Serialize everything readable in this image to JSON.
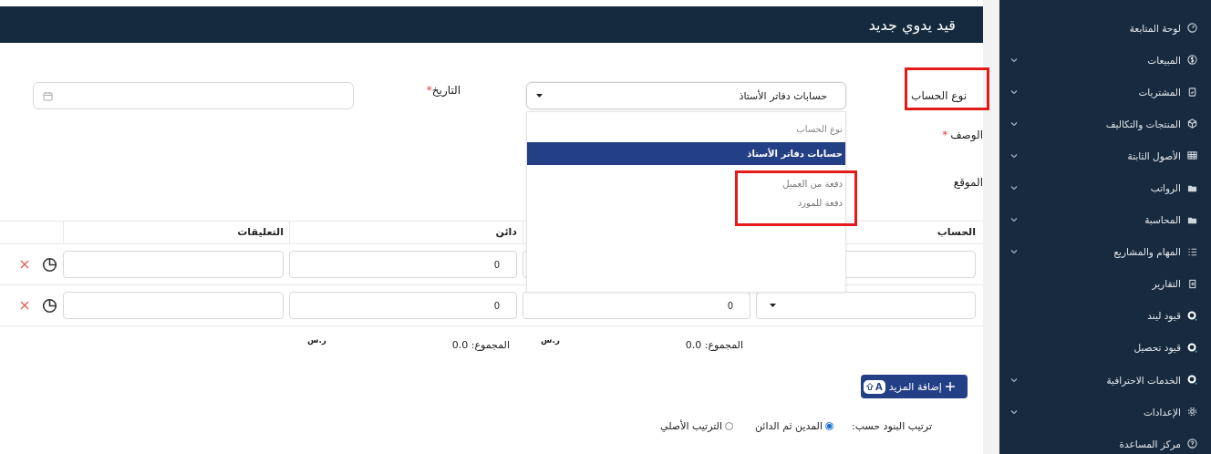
{
  "header": {
    "title": "قيد يدوي جديد"
  },
  "form": {
    "account_type": {
      "label": "نوع الحساب",
      "value": "حسابات دفاتر الأستاذ",
      "highlighted": true,
      "expanded": true,
      "options": [
        {
          "label": "نوع الحساب",
          "kind": "placeholder",
          "selected": false,
          "highlighted": false
        },
        {
          "label": "حسابات دفاتر الأستاذ",
          "kind": "option",
          "selected": true,
          "highlighted": false
        },
        {
          "label": "دفعة من العميل",
          "kind": "option",
          "selected": false,
          "highlighted": true
        },
        {
          "label": "دفعة للمورد",
          "kind": "option",
          "selected": false,
          "highlighted": true
        }
      ]
    },
    "date": {
      "label": "التاريخ",
      "required_mark": "*"
    },
    "description": {
      "label": "الوصف",
      "required_mark": "*"
    },
    "location": {
      "label": "الموقع"
    }
  },
  "table": {
    "columns": [
      {
        "label": "الحساب"
      },
      {},
      {
        "label": "دائن"
      },
      {
        "label": "التعليقات"
      }
    ],
    "rows": [
      {
        "account_field": {
          "kind": "text"
        },
        "credit": "0"
      },
      {
        "account_field": {
          "kind": "select"
        },
        "debit": "0",
        "credit": "0"
      }
    ],
    "totals": [
      {
        "label": "المجموع: 0.0",
        "currency": "ر.س"
      },
      {
        "label": "المجموع: 0.0",
        "currency": "ر.س"
      }
    ]
  },
  "add_button": {
    "label": "إضافة المزيد",
    "shortcut": "A"
  },
  "sort": {
    "label": "ترتيب البنود حسب:",
    "options": [
      {
        "label": "المدين ثم الدائن",
        "selected": true
      },
      {
        "label": "الترتيب الأصلي",
        "selected": false
      }
    ]
  },
  "sidebar": {
    "items": [
      {
        "label": "لوحة المتابعة",
        "expandable": false
      },
      {
        "label": "المبيعات",
        "expandable": true
      },
      {
        "label": "المشتريات",
        "expandable": true
      },
      {
        "label": "المنتجات والتكاليف",
        "expandable": true
      },
      {
        "label": "الأصول الثابتة",
        "expandable": true
      },
      {
        "label": "الرواتب",
        "expandable": true
      },
      {
        "label": "المحاسبة",
        "expandable": true
      },
      {
        "label": "المهام والمشاريع",
        "expandable": true
      },
      {
        "label": "التقارير",
        "expandable": false
      },
      {
        "label": "قيود ليند",
        "expandable": false
      },
      {
        "label": "قيود تحصيل",
        "expandable": false
      },
      {
        "label": "الخدمات الاحترافية",
        "expandable": true
      },
      {
        "label": "الإعدادات",
        "expandable": true
      },
      {
        "label": "مركز المساعدة",
        "expandable": false
      }
    ]
  }
}
